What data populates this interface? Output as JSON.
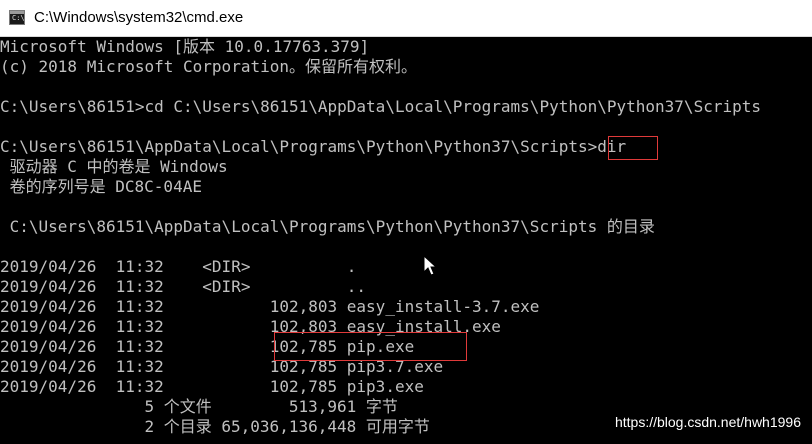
{
  "window": {
    "title": "C:\\Windows\\system32\\cmd.exe",
    "icon": "cmd-icon"
  },
  "console": {
    "lines": [
      "Microsoft Windows [版本 10.0.17763.379]",
      "(c) 2018 Microsoft Corporation。保留所有权利。",
      "",
      "C:\\Users\\86151>cd C:\\Users\\86151\\AppData\\Local\\Programs\\Python\\Python37\\Scripts",
      "",
      "C:\\Users\\86151\\AppData\\Local\\Programs\\Python\\Python37\\Scripts>dir",
      " 驱动器 C 中的卷是 Windows",
      " 卷的序列号是 DC8C-04AE",
      "",
      " C:\\Users\\86151\\AppData\\Local\\Programs\\Python\\Python37\\Scripts 的目录",
      "",
      "2019/04/26  11:32    <DIR>          .",
      "2019/04/26  11:32    <DIR>          ..",
      "2019/04/26  11:32           102,803 easy_install-3.7.exe",
      "2019/04/26  11:32           102,803 easy_install.exe",
      "2019/04/26  11:32           102,785 pip.exe",
      "2019/04/26  11:32           102,785 pip3.7.exe",
      "2019/04/26  11:32           102,785 pip3.exe",
      "               5 个文件        513,961 字节",
      "               2 个目录 65,036,136,448 可用字节"
    ]
  },
  "annotations": {
    "highlight_color": "#e03a3a",
    "highlighted": [
      "dir",
      "102,785 pip.exe"
    ]
  },
  "watermark": "https://blog.csdn.net/hwh1996"
}
